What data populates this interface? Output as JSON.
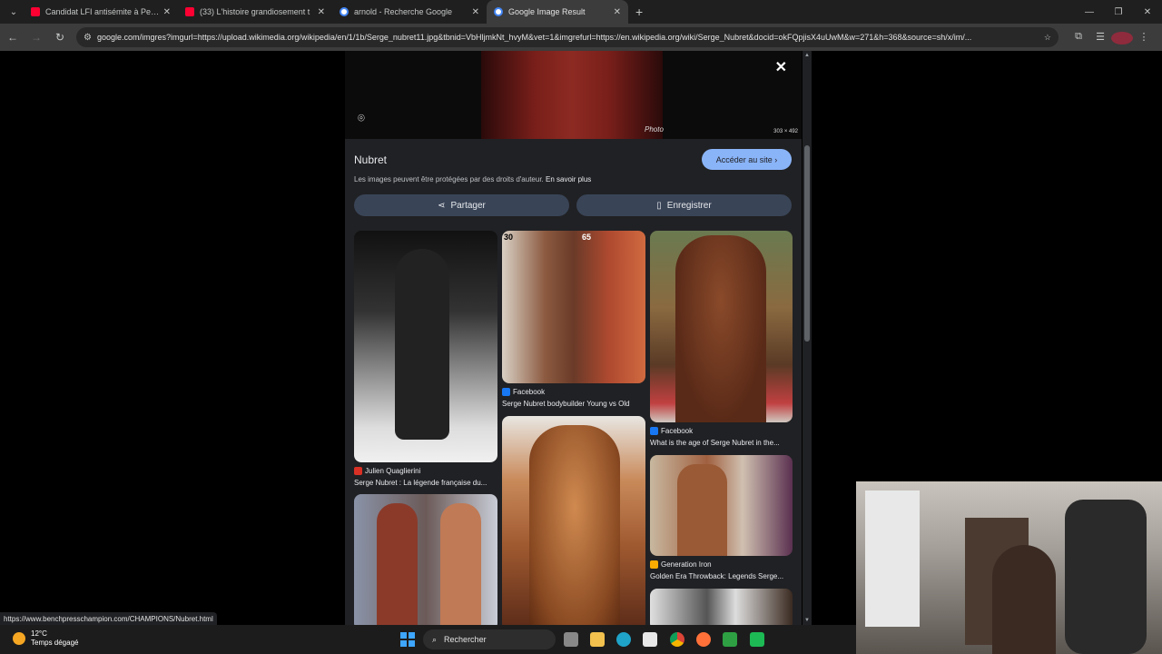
{
  "browser": {
    "tabs": [
      {
        "label": "Candidat LFI antisémite à Perig",
        "favicon": "youtube-icon",
        "active": false
      },
      {
        "label": "(33) L'histoire grandiosement t",
        "favicon": "youtube-icon",
        "active": false
      },
      {
        "label": "arnold - Recherche Google",
        "favicon": "google-icon",
        "active": false
      },
      {
        "label": "Google Image Result",
        "favicon": "google-icon",
        "active": true
      }
    ],
    "url": "google.com/imgres?imgurl=https://upload.wikimedia.org/wikipedia/en/1/1b/Serge_nubret11.jpg&tbnid=VbHljmkNt_hvyM&vet=1&imgrefurl=https://en.wikipedia.org/wiki/Serge_Nubret&docid=okFQpjisX4uUwM&w=271&h=368&source=sh/x/im/..."
  },
  "preview": {
    "dimensions": "303 × 492",
    "signature": "Photo"
  },
  "panel": {
    "title": "Nubret",
    "visit_label": "Accéder au site",
    "copyright_text": "Les images peuvent être protégées par des droits d'auteur.",
    "learn_more": "En savoir plus",
    "share_label": "Partager",
    "save_label": "Enregistrer"
  },
  "results": [
    {
      "source": "Julien Quaglierini",
      "title": "Serge Nubret : La légende française du...",
      "favicon_color": "#d93025"
    },
    {
      "source": "Facebook",
      "title": "Serge Nubret bodybuilder Young vs Old",
      "favicon_color": "#1877f2",
      "overlay_left": "30",
      "overlay_right": "65"
    },
    {
      "source": "Facebook",
      "title": "What is the age of Serge Nubret in the...",
      "favicon_color": "#1877f2"
    },
    {
      "source": "Generation Iron",
      "title": "Golden Era Throwback: Legends Serge...",
      "favicon_color": "#f9ab00"
    }
  ],
  "status_url": "https://www.benchpresschampion.com/CHAMPIONS/Nubret.html",
  "taskbar": {
    "temperature": "12°C",
    "weather": "Temps dégagé",
    "search_placeholder": "Rechercher"
  }
}
